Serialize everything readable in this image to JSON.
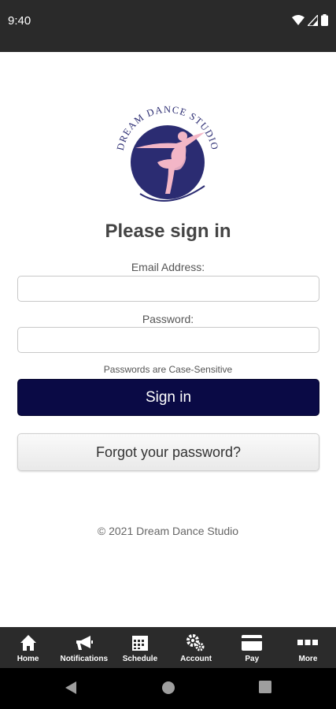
{
  "status_bar": {
    "time": "9:40",
    "icons": [
      "wifi-icon",
      "signal-icon",
      "battery-icon"
    ]
  },
  "logo": {
    "text": "DREAM DANCE STUDIO",
    "colors": {
      "circle": "#2b2c72",
      "dancer": "#f3b6c6",
      "ring": "#2b2c72"
    }
  },
  "login": {
    "title": "Please sign in",
    "email_label": "Email Address:",
    "email_value": "",
    "password_label": "Password:",
    "password_value": "",
    "case_note": "Passwords are Case-Sensitive",
    "signin_label": "Sign in",
    "forgot_label": "Forgot your password?"
  },
  "footer": {
    "copyright": "© 2021 Dream Dance Studio"
  },
  "tab_bar": {
    "items": [
      {
        "label": "Home",
        "icon": "home-icon"
      },
      {
        "label": "Notifications",
        "icon": "megaphone-icon"
      },
      {
        "label": "Schedule",
        "icon": "calendar-icon"
      },
      {
        "label": "Account",
        "icon": "gears-icon"
      },
      {
        "label": "Pay",
        "icon": "credit-card-icon"
      },
      {
        "label": "More",
        "icon": "dots-icon"
      }
    ]
  },
  "nav_bar": {
    "icons": [
      "back-icon",
      "home-circle-icon",
      "recents-icon"
    ]
  },
  "colors": {
    "primary_button": "#0a0a45",
    "status_bar": "#2a2a2a",
    "tab_bar": "#2b2b2b"
  }
}
